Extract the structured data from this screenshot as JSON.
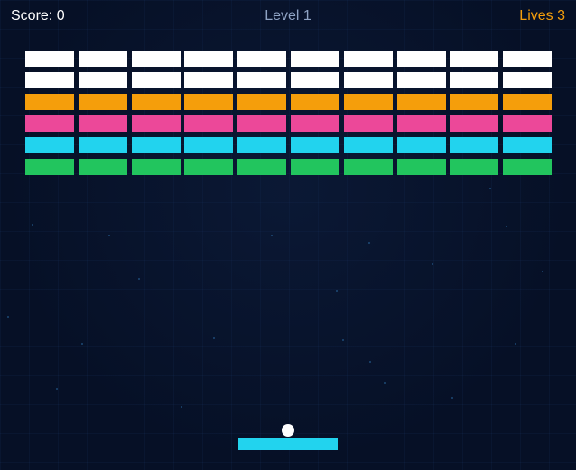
{
  "hud": {
    "score_label": "Score: 0",
    "level_label": "Level 1",
    "lives_label": "Lives 3"
  },
  "colors": {
    "background": "#061026",
    "score_text": "#ffffff",
    "level_text": "#8fa3c4",
    "lives_text": "#f59e0b",
    "paddle": "#22d3ee",
    "ball": "#ffffff"
  },
  "bricks": {
    "columns": 10,
    "rows": [
      {
        "color": "#ffffff"
      },
      {
        "color": "#ffffff"
      },
      {
        "color": "#f59e0b"
      },
      {
        "color": "#ec4899"
      },
      {
        "color": "#22d3ee"
      },
      {
        "color": "#22c55e"
      }
    ]
  }
}
